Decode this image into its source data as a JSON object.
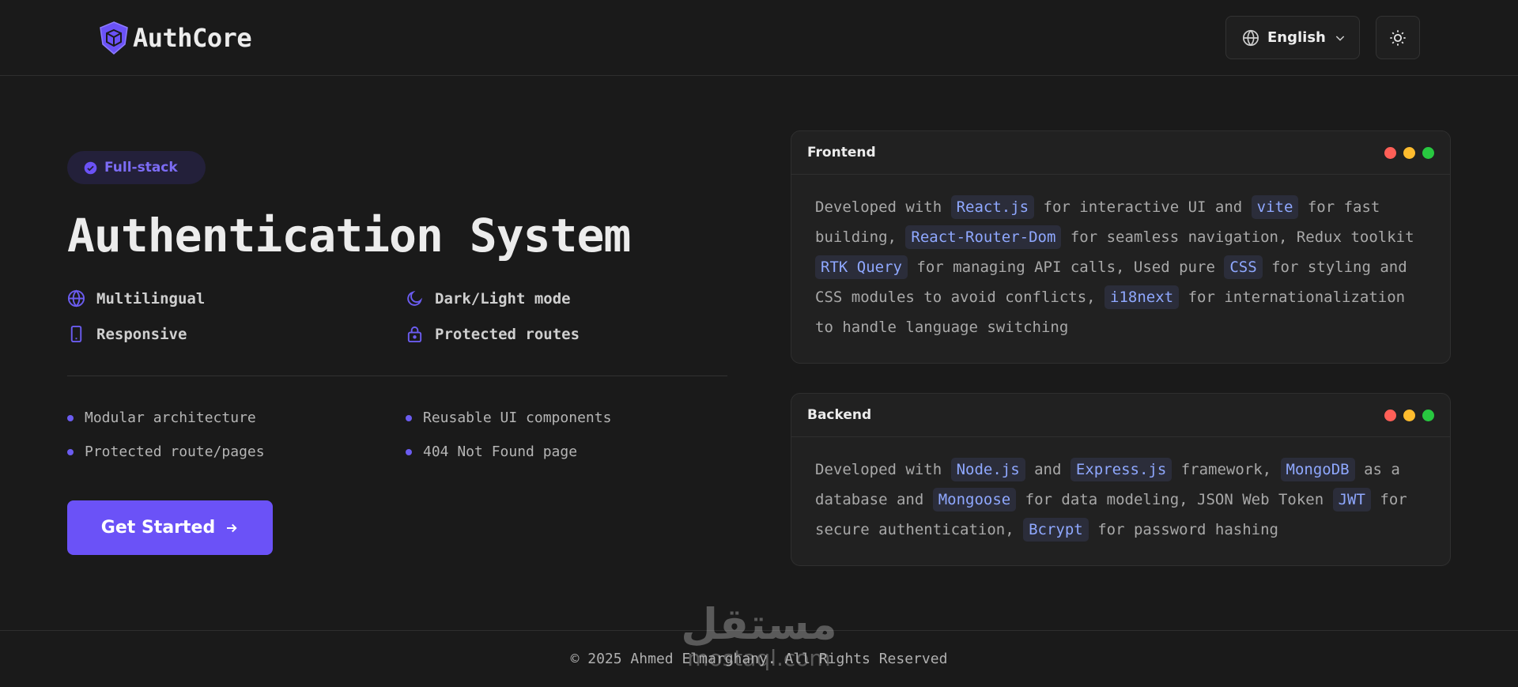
{
  "header": {
    "brand": "AuthCore",
    "language": "English",
    "icons": {
      "logo": "shield-cube-icon",
      "language": "globe-icon",
      "chevron": "chevron-down-icon",
      "theme": "sun-icon"
    }
  },
  "hero": {
    "badge": "Full-stack",
    "title": "Authentication System",
    "features": [
      {
        "label": "Multilingual",
        "icon": "globe-icon"
      },
      {
        "label": "Dark/Light mode",
        "icon": "moon-icon"
      },
      {
        "label": "Responsive",
        "icon": "smartphone-icon"
      },
      {
        "label": "Protected routes",
        "icon": "lock-icon"
      }
    ],
    "bullets": [
      "Modular architecture",
      "Reusable UI components",
      "Protected route/pages",
      "404 Not Found page"
    ],
    "cta": "Get Started",
    "cta_icon": "arrow-right-icon"
  },
  "cards": {
    "frontend": {
      "title": "Frontend",
      "segments": [
        "Developed with ",
        "React.js",
        " for interactive UI and ",
        "vite",
        " for fast building, ",
        "React-Router-Dom",
        " for seamless navigation, Redux toolkit ",
        "RTK Query",
        " for managing API calls, Used pure ",
        "CSS",
        " for styling and CSS modules to avoid conflicts, ",
        "i18next",
        " for internationalization to handle language switching"
      ]
    },
    "backend": {
      "title": "Backend",
      "segments": [
        "Developed with ",
        "Node.js",
        " and ",
        "Express.js",
        " framework, ",
        "MongoDB",
        " as a database and ",
        "Mongoose",
        " for data modeling, JSON Web Token ",
        "JWT",
        " for secure authentication, ",
        "Bcrypt",
        " for password hashing"
      ]
    }
  },
  "window_dots": [
    "#ff5f57",
    "#febc2e",
    "#28c840"
  ],
  "colors": {
    "accent": "#6b52f7",
    "background": "#1a1a1a",
    "code_text": "#8fa8ff"
  },
  "footer": {
    "copyright": "© 2025 Ahmed Elmarghany. All Rights Reserved",
    "watermark_text": "مستقل",
    "watermark_url": "mostaql.com"
  }
}
